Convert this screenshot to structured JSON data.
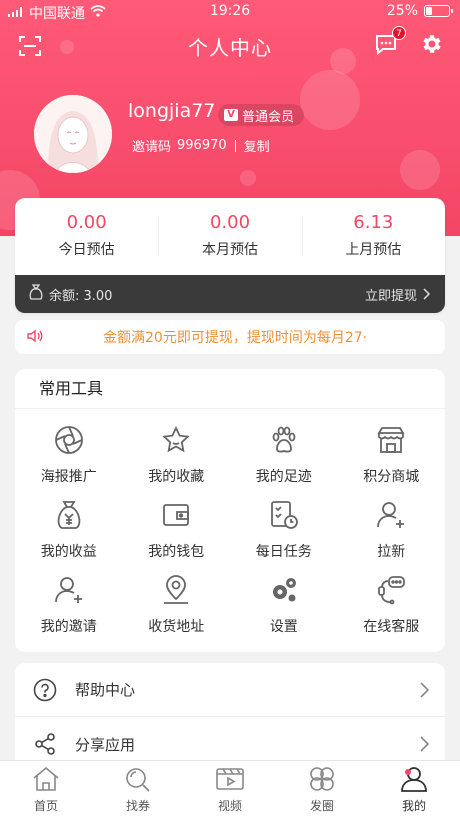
{
  "status_bar": {
    "carrier": "中国联通",
    "time": "19:26",
    "battery": "25%"
  },
  "header": {
    "title": "个人中心",
    "message_badge": "7"
  },
  "profile": {
    "username": "longjia77",
    "member_level": "普通会员",
    "invite_label": "邀请码",
    "invite_code": "996970",
    "copy_label": "复制"
  },
  "earnings": [
    {
      "value": "0.00",
      "label": "今日预估"
    },
    {
      "value": "0.00",
      "label": "本月预估"
    },
    {
      "value": "6.13",
      "label": "上月预估"
    }
  ],
  "balance": {
    "text": "余额: 3.00",
    "withdraw_label": "立即提现"
  },
  "notice": {
    "text": "金额满20元即可提现，提现时间为每月27·"
  },
  "tools": {
    "title": "常用工具",
    "items": [
      {
        "label": "海报推广",
        "icon": "aperture-icon"
      },
      {
        "label": "我的收藏",
        "icon": "star-icon"
      },
      {
        "label": "我的足迹",
        "icon": "paw-icon"
      },
      {
        "label": "积分商城",
        "icon": "store-icon"
      },
      {
        "label": "我的收益",
        "icon": "money-bag-icon"
      },
      {
        "label": "我的钱包",
        "icon": "wallet-icon"
      },
      {
        "label": "每日任务",
        "icon": "task-icon"
      },
      {
        "label": "拉新",
        "icon": "add-user-icon"
      },
      {
        "label": "我的邀请",
        "icon": "invite-icon"
      },
      {
        "label": "收货地址",
        "icon": "location-icon"
      },
      {
        "label": "设置",
        "icon": "gears-icon"
      },
      {
        "label": "在线客服",
        "icon": "customer-service-icon"
      }
    ]
  },
  "menu": [
    {
      "label": "帮助中心",
      "icon": "help-icon"
    },
    {
      "label": "分享应用",
      "icon": "share-icon"
    }
  ],
  "tabbar": [
    {
      "label": "首页",
      "icon": "home-icon"
    },
    {
      "label": "找券",
      "icon": "search-coupon-icon"
    },
    {
      "label": "视频",
      "icon": "video-icon"
    },
    {
      "label": "发圈",
      "icon": "circles-icon"
    },
    {
      "label": "我的",
      "icon": "profile-icon"
    }
  ],
  "colors": {
    "brand": "#f44565",
    "notice": "#f09036",
    "balance_bar": "#3a3a3a"
  }
}
